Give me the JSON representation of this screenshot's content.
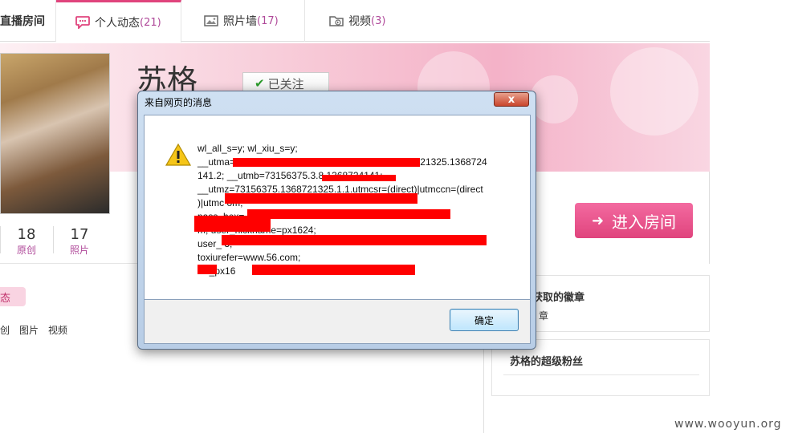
{
  "tabs": [
    {
      "label": "直播房间",
      "count": ""
    },
    {
      "label": "个人动态",
      "count": "(21)"
    },
    {
      "label": "照片墙",
      "count": "(17)"
    },
    {
      "label": "视频",
      "count": "(3)"
    }
  ],
  "profile": {
    "name": "苏格",
    "follow_label": "已关注",
    "stats": [
      {
        "value": "18",
        "label": "原创"
      },
      {
        "value": "17",
        "label": "照片"
      }
    ],
    "enter_room_label": "进入房间"
  },
  "left": {
    "tag_label": "态",
    "subnav": [
      "创",
      "图片",
      "视频"
    ]
  },
  "sidebar": {
    "badge_title": "获取的徽章",
    "badge_sub": "章",
    "fans_title": "苏格的超级粉丝"
  },
  "dialog": {
    "title": "来自网页的消息",
    "close_label": "x",
    "lines": [
      "wl_all_s=y; wl_xiu_s=y;",
      "__utma=73156375.1513807065.1368721325.1368721325.1368724",
      "141.2; __utmb=73156375.3.8.1368724141;",
      "__utmz=73156375.1368721325.1.1.utmcsr=(direct)|utmccn=(direct",
      ")|utmc                                                    om;",
      "pass_hex=                                                     514;",
      "                    m; user_nickname=px1624;",
      "user_                                                                 3;",
      "toxiurefer=www.56.com;",
      "     V5_px16"
    ],
    "ok_label": "确定"
  },
  "watermark": "www.wooyun.org",
  "colors": {
    "accent": "#e0447d",
    "count": "#b04a9a",
    "redaction": "#ff0000"
  }
}
